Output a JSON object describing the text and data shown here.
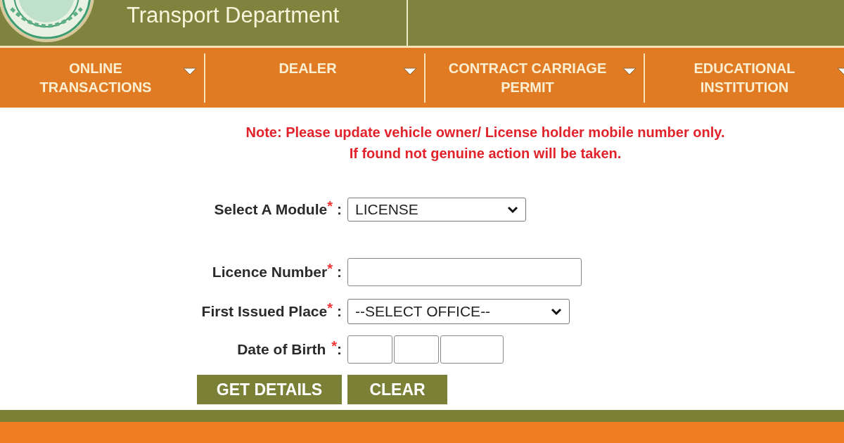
{
  "header": {
    "title": "Transport Department"
  },
  "nav": [
    {
      "label": "ONLINE TRANSACTIONS"
    },
    {
      "label": "DEALER"
    },
    {
      "label": "CONTRACT CARRIAGE PERMIT"
    },
    {
      "label": "EDUCATIONAL INSTITUTION"
    }
  ],
  "note": [
    "Note: Please update vehicle owner/ License holder mobile number only.",
    "If found not genuine action will be taken."
  ],
  "fields": [
    {
      "kind": "select",
      "label": "Select A Module",
      "marker": "*",
      "colon": ":",
      "value": "LICENSE"
    },
    {
      "kind": "text",
      "label": "Licence Number",
      "marker": "*",
      "colon": ":"
    },
    {
      "kind": "select",
      "label": "First Issued Place",
      "marker": "*",
      "colon": ":",
      "value": "--SELECT OFFICE--"
    },
    {
      "kind": "date",
      "label": "Date of Birth",
      "marker": "*",
      "colon": ":"
    }
  ],
  "buttons": [
    {
      "label": "GET DETAILS"
    },
    {
      "label": "CLEAR"
    }
  ]
}
